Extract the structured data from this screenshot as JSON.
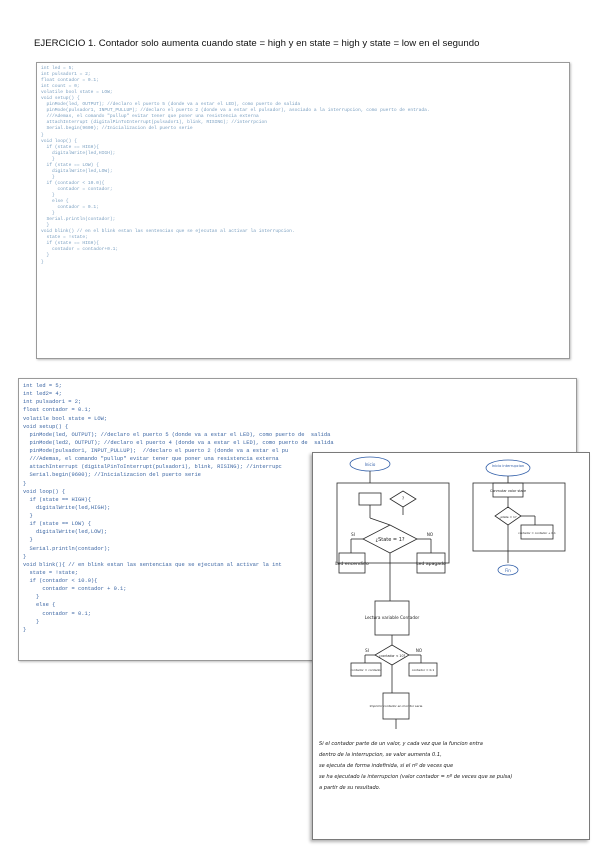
{
  "heading": "EJERCICIO 1. Contador solo aumenta cuando state = high y en state = high y state = low en el segundo",
  "screenshot_top": {
    "lines": [
      "int led = 5;",
      "int pulsador1 = 2;",
      "float contador = 0.1;",
      "int count = 0;",
      "volatile bool state = LOW;",
      "",
      "void setup() {",
      "  pinMode(led, OUTPUT); //declaro el puerto 5 (donde va a estar el LED), como puerto de salida",
      "  pinMode(pulsador1, INPUT_PULLUP); //declaro el puerto 2 (donde va a estar el pulsador), asociado a la interrupcion, como puerto de entrada.",
      "  ///Ademas, el comando \"pullup\" evitar tener que poner una resistencia externa",
      "  attachInterrupt (digitalPinToInterrupt(pulsador1), blink, RISING); //interrpcion",
      "  Serial.begin(9600); //Inicializacion del puerto serie",
      "}",
      "",
      "",
      "",
      "void loop() {",
      "  if (state == HIGH){",
      "    digitalWrite(led,HIGH);",
      "    }",
      "  if (state == LOW) {",
      "    digitalWrite(led,LOW);",
      "    }",
      "",
      "  if (contador < 10.0){",
      "      contador = contador;",
      "    }",
      "    else {",
      "      contador = 0.1;",
      "    }",
      "",
      "  Serial.println(contador);",
      "  }",
      "",
      "void blink() // en el blink estan las sentencias que se ejecutan al activar la interrupcion.",
      "  state = !state;",
      "  if (state == HIGH){",
      "    contador = contador+0.1;",
      "  }",
      "",
      "}"
    ]
  },
  "screenshot_bottom": {
    "lines": [
      "int led = 5;",
      "int led2= 4;",
      "int pulsador1 = 2;",
      "float contador = 0.1;",
      "volatile bool state = LOW;",
      "",
      "void setup() {",
      "  pinMode(led, OUTPUT); //declaro el puerto 5 (donde va a estar el LED), como puerto de  salida",
      "  pinMode(led2, OUTPUT); //declaro el puerto 4 (donde va a estar el LED), como puerto de  salida",
      "  pinMode(pulsador1, INPUT_PULLUP);  //declaro el puerto 2 (donde va a estar el pu",
      "  ///Ademas, el comando \"pullup\" evitar tener que poner una resistencia externa",
      "  attachInterrupt (digitalPinToInterrupt(pulsador1), blink, RISING); //interrupc",
      "  Serial.begin(9600); //Inicializacion del puerto serie",
      "}",
      "",
      "void loop() {",
      "  if (state == HIGH){",
      "    digitalWrite(led,HIGH);",
      "  }",
      "  if (state == LOW) {",
      "    digitalWrite(led,LOW);",
      "  }",
      "  Serial.println(contador);",
      "}",
      "",
      "void blink(){ // en blink estan las sentencias que se ejecutan al activar la int",
      "  state = !state;",
      "  if (contador < 10.0){",
      "      contador = contador + 0.1;",
      "    }",
      "    else {",
      "      contador = 0.1;",
      "    }",
      "}"
    ]
  },
  "flowchart": {
    "start_left": "Inicio",
    "start_right": "Inicio interrupcion",
    "decision_top_left": "?",
    "decision_state": "¿State = 1?",
    "led_on": "Led encendido",
    "led_off": "Led apagado",
    "read_counter": "Lectura variable Contador",
    "decision_counter": "¿contador < 10?",
    "counter_same": "contador = contador",
    "counter_reset": "contador = 0.1",
    "print_counter": "Imprimir contador en monitor serie",
    "right_box": "Conmutar valor state",
    "decision_right": "¿state = 1?",
    "right_increment": "contador = contador + 0.1",
    "end_right": "Fin",
    "yes": "SI",
    "no": "NO",
    "colors": {
      "ink": "#222222",
      "blue": "#2f5da8"
    }
  },
  "note_lines": [
    "Si el contador parte de un valor, y cada vez que la funcion entra",
    "dentro de la interrupcion, se valor aumenta 0.1,",
    "se ejecuta de forma indefinida, si el nº de veces que",
    "se ha ejecutado la interrupcion (valor contador = nº de veces que se pulsa)",
    "a partir de su resultado."
  ]
}
